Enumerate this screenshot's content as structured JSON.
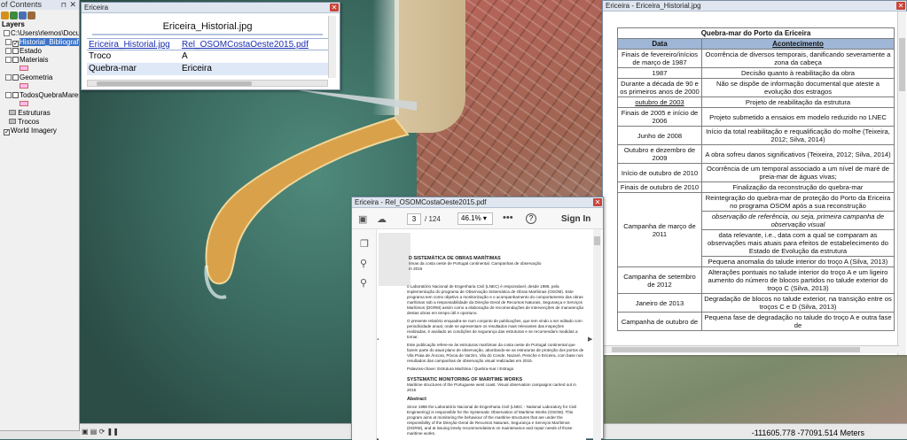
{
  "toc": {
    "title": "of Contents",
    "header": "Layers",
    "path": "C:\\Users\\rlemos\\Docum...",
    "items": [
      {
        "label": "Historial_Bibliografia",
        "checked": true,
        "selected": true
      },
      {
        "label": "Estado",
        "checked": false
      },
      {
        "label": "Materiais",
        "checked": false
      },
      {
        "label": "Geometria",
        "checked": false
      },
      {
        "label": "TodosQuebraMares",
        "checked": false
      },
      {
        "label": "Estruturas"
      },
      {
        "label": "Trocos"
      },
      {
        "label": "World Imagery",
        "checked": true
      }
    ]
  },
  "popup": {
    "window_title": "Ericeira",
    "image_title": "Ericeira_Historial.jpg",
    "link1": "Ericeira_Historial.jpg",
    "link2": "Rel_OSOMCostaOeste2015.pdf",
    "rows": [
      {
        "field": "Troco",
        "value": "A"
      },
      {
        "field": "Quebra-mar",
        "value": "Ericeira"
      }
    ]
  },
  "historial": {
    "window_title": "Ericeira - Ericeira_Historial.jpg",
    "caption": "Quebra-mar do Porto da Ericeira",
    "col_date": "Data",
    "col_event": "Acontecimento",
    "rows": [
      {
        "date": "Finais de fevereiro/inícios de março de 1987",
        "event": "Ocorrência de diversos temporais, danificando severamente a zona da cabeça"
      },
      {
        "date": "1987",
        "event": "Decisão quanto à reabilitação da obra"
      },
      {
        "date": "Durante a década de 90 e os primeiros anos de 2000",
        "event": "Não se dispõe de informação documental que ateste a evolução dos estragos"
      },
      {
        "date": "outubro de 2003",
        "event": "Projeto de reabilitação da estrutura"
      },
      {
        "date": "Finais de 2005 e início de 2006",
        "event": "Projeto submetido a ensaios em modelo reduzido no LNEC"
      },
      {
        "date": "Junho de 2008",
        "event": "Início da total reabilitação e requalificação do molhe (Teixeira, 2012; Silva, 2014)"
      },
      {
        "date": "Outubro e dezembro de 2009",
        "event": "A obra sofreu danos significativos (Teixeira, 2012; Silva, 2014)"
      },
      {
        "date": "Início de outubro de 2010",
        "event": "Ocorrência de um temporal associado a um nível de maré de preia-mar de águas vivas;"
      },
      {
        "date": "Finais de outubro de 2010",
        "event": "Finalização da reconstrução do quebra-mar"
      },
      {
        "date": "Campanha de março de 2011",
        "event_lines": [
          "Reintegração do quebra-mar de proteção do Porto da Ericeira no programa OSOM após a sua reconstrução",
          "observação de referência, ou seja, primeira campanha de observação visual",
          "data relevante, i.e., data com a qual se comparam as observações mais atuais para efeitos de estabelecimento do Estado de Evolução da estrutura",
          "Pequena anomalia do talude interior do troço A (Silva, 2013)"
        ]
      },
      {
        "date": "Campanha de setembro de 2012",
        "event": "Alterações pontuais no talude interior do troço A e um ligeiro aumento do número de blocos partidos no talude exterior do troço C (Silva, 2013)"
      },
      {
        "date": "Janeiro de 2013",
        "event": "Degradação de blocos no talude exterior, na transição entre os troços C e D (Silva, 2013)"
      },
      {
        "date": "Campanha de outubro de",
        "event": "Pequena fase de degradação no talude do troço A e outra fase de"
      }
    ]
  },
  "pdf": {
    "window_title": "Ericeira - Rel_OSOMCostaOeste2015.pdf",
    "page_current": "3",
    "page_total": "/ 124",
    "zoom": "46.1%",
    "more": "•••",
    "help": "?",
    "signin": "Sign In",
    "heading": "D SISTEMÁTICA DE OBRAS MARÍTIMAS",
    "subheading": "rimas da costa oeste de Portugal continental. Campanhas de observação",
    "subheading2": "m 2015",
    "p1": "o Laboratório Nacional de Engenharia Civil (LNEC) é responsável, desde 1986, pela implementação do programa de Observação Sistemática de Obras Marítimas (OSOM). Este programa tem como objetivo a monitorização e o acompanhamento do comportamento das obras marítimas sob a responsabilidade da Direção-Geral de Recursos Naturais, Segurança e Serviços Marítimos (DGRM) assim como a elaboração de recomendações de intervenções de manutenção destas obras em tempo útil e oportuno.",
    "p2": "O presente relatório enquadra-se num conjunto de publicações, que tem vindo a ser editado com periodicidade anual, onde se apresentam os resultados mais relevantes das inspeções realizadas, é avaliado as condições de segurança das estruturas e se recomendam medidas a tomar.",
    "p3": "Este publicação refere-se às estruturas marítimas da costa oeste de Portugal continental que fazem parte do atual plano de observação, abordando-se as estruturas de proteção dos portos de Vila Praia de Âncora, Póvoa de Varzim, Vila do Conde, Nazaré, Peniche e Ericeira, com base nos resultados das campanhas de observação visual realizadas em 2015.",
    "keywords": "Palavras-chave:   Estrutura Marítima / Quebra-mar / Estrago",
    "en_heading": "SYSTEMATIC MONITORING OF MARITIME WORKS",
    "en_sub": "Maritime structures of the Portuguese west coast. Visual observation campaigns carried out in 2015",
    "abstract": "Abstract",
    "en_p": "Since 1986 the Laboratório Nacional de Engenharia Civil (LNEC - National Laboratory for Civil Engineering) is responsible for the Systematic Observation of Maritime Works (OSOM). This program aims at monitoring the behaviour of the maritime structures that are under the responsibility of the Direção-Geral de Recursos Naturais, Segurança e Serviços Marítimos (DGRM), and at issuing timely recommendations on maintenance and repair needs of those maritime works."
  },
  "statusbar": {
    "coords": "-111605.778  -77091.514 Meters"
  }
}
